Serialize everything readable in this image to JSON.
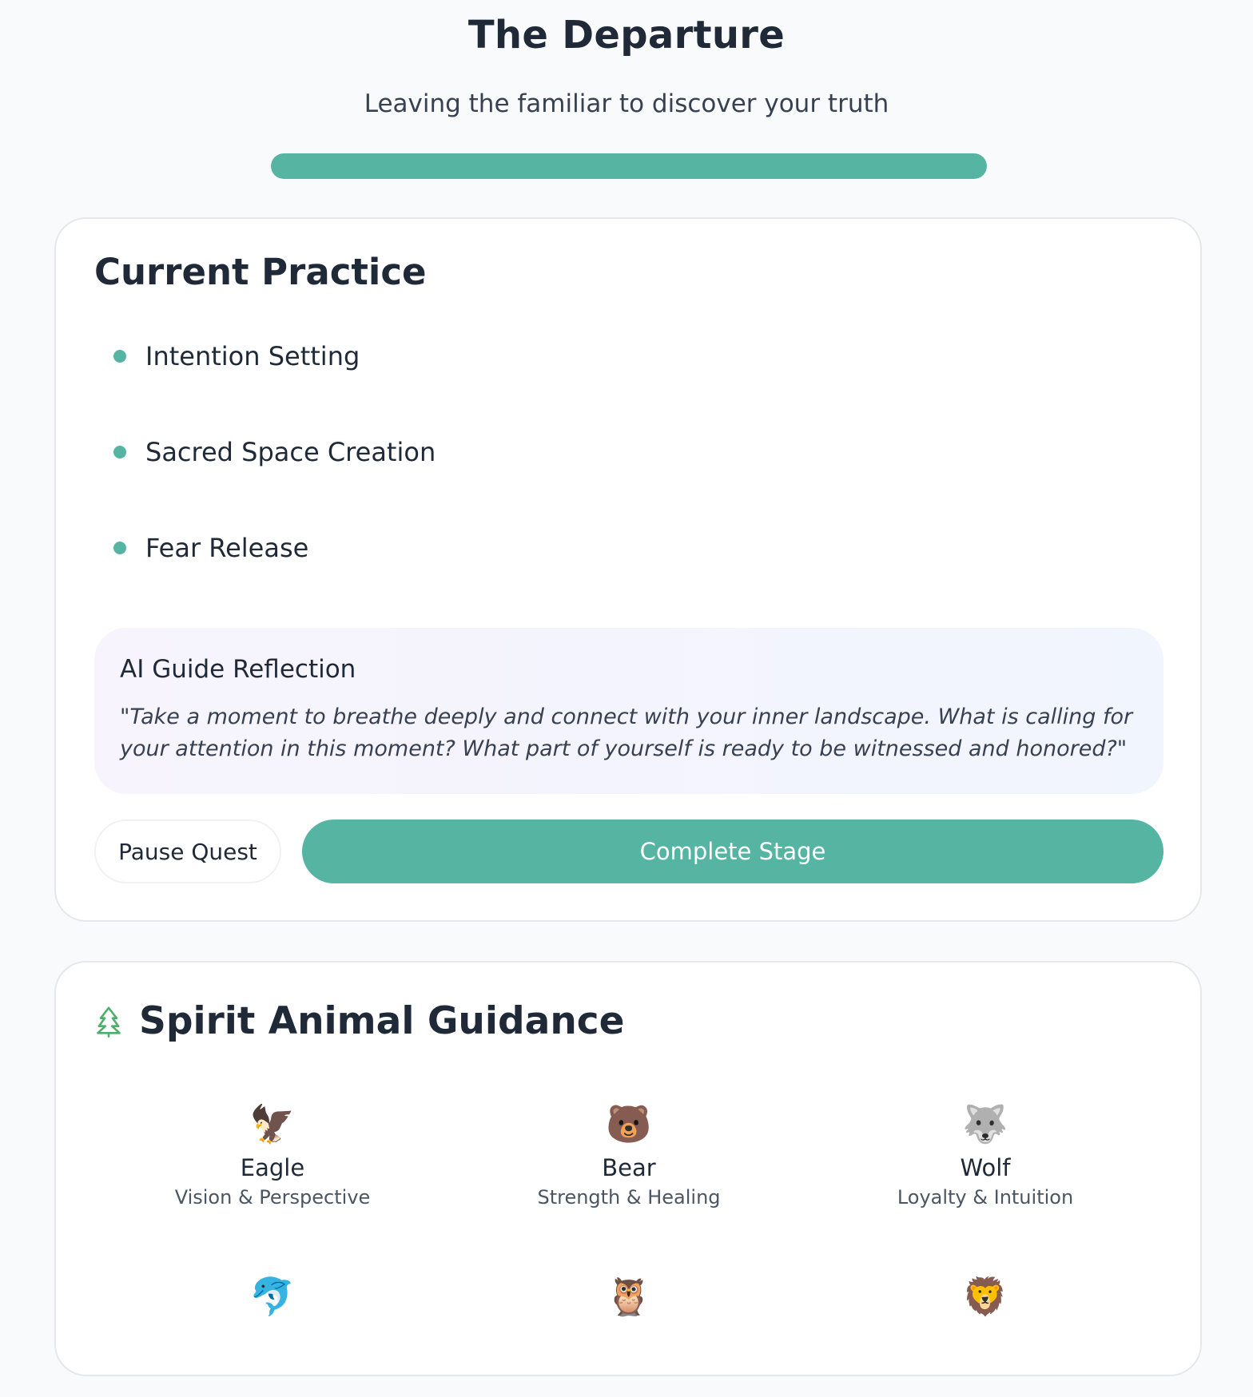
{
  "header": {
    "title": "The Departure",
    "subtitle": "Leaving the familiar to discover your truth",
    "progress_fraction": 1.0
  },
  "practice": {
    "heading": "Current Practice",
    "items": [
      {
        "label": "Intention Setting"
      },
      {
        "label": "Sacred Space Creation"
      },
      {
        "label": "Fear Release"
      }
    ],
    "reflection": {
      "title": "AI Guide Reflection",
      "text": "\"Take a moment to breathe deeply and connect with your inner landscape. What is calling for your attention in this moment? What part of yourself is ready to be witnessed and honored?\""
    },
    "pause_label": "Pause Quest",
    "complete_label": "Complete Stage"
  },
  "spirit": {
    "icon": "tree-icon",
    "heading": "Spirit Animal Guidance",
    "animals": [
      {
        "emoji": "🦅",
        "name": "Eagle",
        "trait": "Vision & Perspective"
      },
      {
        "emoji": "🐻",
        "name": "Bear",
        "trait": "Strength & Healing"
      },
      {
        "emoji": "🐺",
        "name": "Wolf",
        "trait": "Loyalty & Intuition"
      },
      {
        "emoji": "🐬",
        "name": "",
        "trait": ""
      },
      {
        "emoji": "🦉",
        "name": "",
        "trait": ""
      },
      {
        "emoji": "🦁",
        "name": "",
        "trait": ""
      }
    ]
  },
  "colors": {
    "accent": "#55b5a2",
    "background": "#f8fafc",
    "tree_icon": "#4caf6a"
  }
}
